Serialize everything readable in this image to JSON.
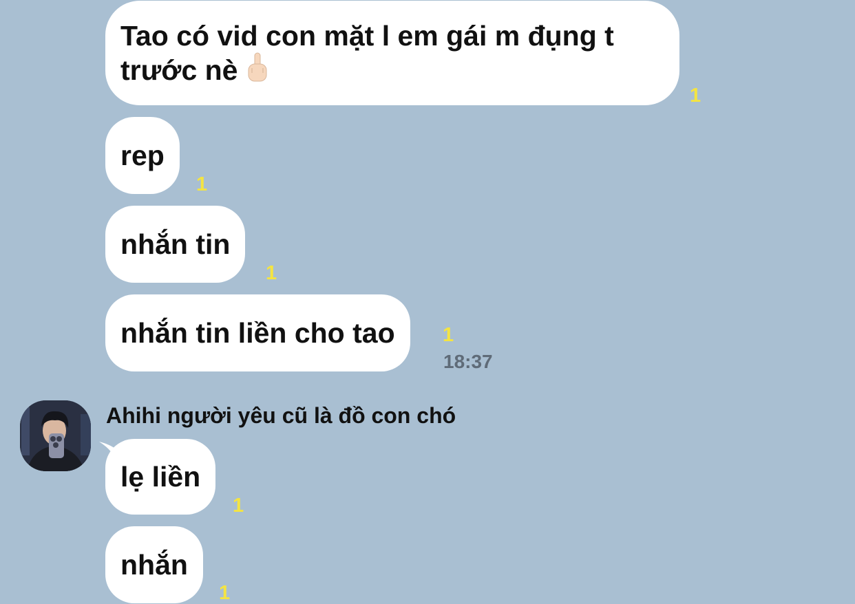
{
  "colors": {
    "background": "#a9bfd2",
    "bubble": "#ffffff",
    "unread_marker": "#f4e442",
    "timestamp": "#5f6b78"
  },
  "messages_out": [
    {
      "text": "Tao có vid con mặt l em gái m đụng t trước nè",
      "emoji": "middle-finger-icon",
      "unread": "1"
    },
    {
      "text": "rep",
      "unread": "1"
    },
    {
      "text": "nhắn tin",
      "unread": "1"
    },
    {
      "text": "nhắn tin liền cho tao",
      "unread": "1",
      "time": "18:37"
    }
  ],
  "incoming": {
    "sender_name": "Ahihi người yêu cũ là đồ con chó",
    "avatar": "avatar",
    "messages": [
      {
        "text": "lẹ liền",
        "unread": "1"
      },
      {
        "text": "nhắn",
        "unread": "1"
      }
    ]
  }
}
